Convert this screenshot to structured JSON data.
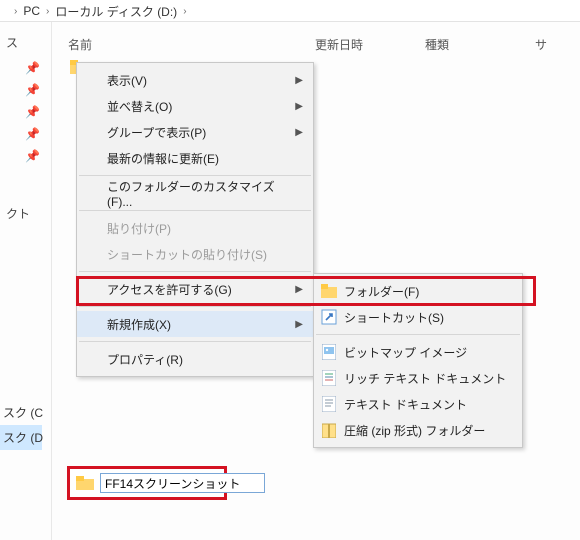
{
  "address": {
    "pc": "PC",
    "drive": "ローカル ディスク (D:)"
  },
  "sidebar": {
    "quick": "ス",
    "section2": "クト",
    "tail1": "スク (C",
    "tail2": "スク (D"
  },
  "columns": {
    "name": "名前",
    "date": "更新日時",
    "type": "種類",
    "size": "サ"
  },
  "context_menu": {
    "view": "表示(V)",
    "sort": "並べ替え(O)",
    "group": "グループで表示(P)",
    "refresh": "最新の情報に更新(E)",
    "customize": "このフォルダーのカスタマイズ(F)...",
    "paste": "貼り付け(P)",
    "paste_shortcut": "ショートカットの貼り付け(S)",
    "give_access": "アクセスを許可する(G)",
    "new": "新規作成(X)",
    "properties": "プロパティ(R)"
  },
  "sub_menu": {
    "folder": "フォルダー(F)",
    "shortcut": "ショートカット(S)",
    "bmp": "ビットマップ イメージ",
    "rtf": "リッチ テキスト ドキュメント",
    "txt": "テキスト ドキュメント",
    "zip": "圧縮 (zip 形式) フォルダー"
  },
  "rename": {
    "value": "FF14スクリーンショット"
  }
}
